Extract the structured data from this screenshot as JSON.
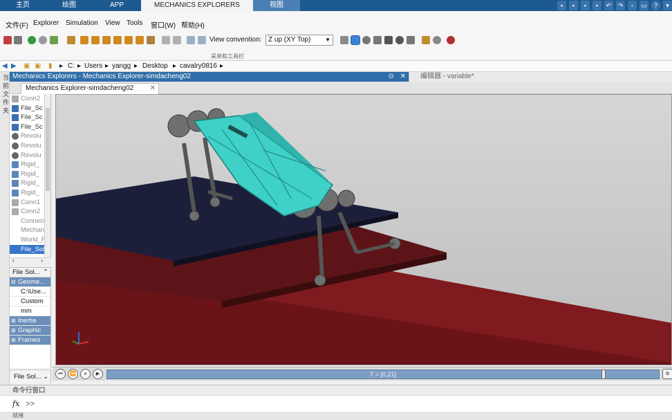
{
  "ribbon_tabs": [
    {
      "label": "主页"
    },
    {
      "label": "绘图"
    },
    {
      "label": "APP"
    },
    {
      "label": "MECHANICS EXPLORERS"
    },
    {
      "label": "视图"
    }
  ],
  "menu": [
    "文件(F)",
    "Explorer",
    "Simulation",
    "View",
    "Tools",
    "窗口(W)",
    "帮助(H)"
  ],
  "toolbar": {
    "view_convention_label": "View convention:",
    "view_convention_value": "Z up (XY Top)",
    "section_label": "采单和工具栏"
  },
  "address": {
    "segments": [
      "C:",
      "Users",
      "yangg",
      "Desktop",
      "cavalry0816"
    ]
  },
  "left_strip": [
    "当",
    "前",
    "文",
    "件",
    "夹"
  ],
  "window": {
    "title": "Mechanics Explorers - Mechanics Explorer-simdacheng02",
    "doc_tab": "Mechanics Explorer-simdacheng02",
    "close_glyph": "✕",
    "editor_title": "编辑器 - variable*"
  },
  "tree": {
    "items": [
      {
        "label": "Conn2",
        "icon": "connector-icon",
        "state": "gray"
      },
      {
        "label": "File_Sc",
        "icon": "file-solid-icon",
        "state": "normal"
      },
      {
        "label": "File_Sc",
        "icon": "file-solid-icon",
        "state": "normal"
      },
      {
        "label": "File_Sc",
        "icon": "file-solid-icon",
        "state": "normal"
      },
      {
        "label": "Revolu",
        "icon": "revolute-joint-icon",
        "state": "gray"
      },
      {
        "label": "Revolu",
        "icon": "revolute-joint-icon",
        "state": "gray"
      },
      {
        "label": "Revolu",
        "icon": "revolute-joint-icon",
        "state": "gray"
      },
      {
        "label": "Rigid_",
        "icon": "rigid-transform-icon",
        "state": "gray"
      },
      {
        "label": "Rigid_",
        "icon": "rigid-transform-icon",
        "state": "gray"
      },
      {
        "label": "Rigid_",
        "icon": "rigid-transform-icon",
        "state": "gray"
      },
      {
        "label": "Rigid_",
        "icon": "rigid-transform-icon",
        "state": "gray"
      },
      {
        "label": "Conn1",
        "icon": "connector-icon",
        "state": "gray"
      },
      {
        "label": "Conn2",
        "icon": "connector-icon",
        "state": "gray"
      },
      {
        "label": "Connectio",
        "icon": "",
        "state": "gray"
      },
      {
        "label": "Mechanis",
        "icon": "",
        "state": "gray"
      },
      {
        "label": "World_Fr",
        "icon": "",
        "state": "gray"
      },
      {
        "label": "File_Solic",
        "icon": "",
        "state": "selected"
      }
    ]
  },
  "props": {
    "header": "File Sol...",
    "rows": [
      {
        "type": "group",
        "label": "Geome..."
      },
      {
        "type": "val",
        "label": "C:\\Use..."
      },
      {
        "type": "val",
        "label": "Custom"
      },
      {
        "type": "val",
        "label": "mm"
      },
      {
        "type": "groupc",
        "label": "Inertia"
      },
      {
        "type": "groupc",
        "label": "Graphic"
      },
      {
        "type": "groupc",
        "label": "Frames"
      }
    ],
    "footer": "File Sol..."
  },
  "playback": {
    "time_label": "T = [0,21]",
    "progress": 0.9,
    "buttons": [
      "⏮",
      "⏪",
      "⏸",
      "▶"
    ]
  },
  "command": {
    "title": "命令行窗口",
    "fx": "fx",
    "prompt": ">>",
    "status": "就绪"
  },
  "colors": {
    "ribbon_blue": "#1d5a92",
    "robot_body": "#3fd0c8",
    "ground_red": "#8e1b1f",
    "dark_plate": "#1c1f3a"
  }
}
